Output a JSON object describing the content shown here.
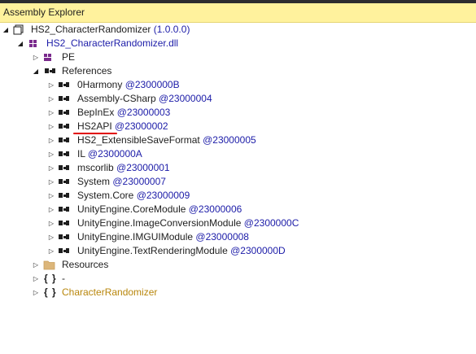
{
  "panel": {
    "title": "Assembly Explorer"
  },
  "assembly": {
    "name": "HS2_CharacterRandomizer",
    "version": "(1.0.0.0)"
  },
  "module": {
    "name": "HS2_CharacterRandomizer.dll"
  },
  "nodes": {
    "pe": "PE",
    "references": "References",
    "resources": "Resources",
    "ns_empty": "-",
    "ns_main": "CharacterRandomizer"
  },
  "references": [
    {
      "name": "0Harmony",
      "token": "@2300000B"
    },
    {
      "name": "Assembly-CSharp",
      "token": "@23000004"
    },
    {
      "name": "BepInEx",
      "token": "@23000003"
    },
    {
      "name": "HS2API",
      "token": "@23000002"
    },
    {
      "name": "HS2_ExtensibleSaveFormat",
      "token": "@23000005"
    },
    {
      "name": "IL",
      "token": "@2300000A"
    },
    {
      "name": "mscorlib",
      "token": "@23000001"
    },
    {
      "name": "System",
      "token": "@23000007"
    },
    {
      "name": "System.Core",
      "token": "@23000009"
    },
    {
      "name": "UnityEngine.CoreModule",
      "token": "@23000006"
    },
    {
      "name": "UnityEngine.ImageConversionModule",
      "token": "@2300000C"
    },
    {
      "name": "UnityEngine.IMGUIModule",
      "token": "@23000008"
    },
    {
      "name": "UnityEngine.TextRenderingModule",
      "token": "@2300000D"
    }
  ],
  "colors": {
    "titlebar": "#fff29d",
    "token": "#1c1ca8",
    "namespace": "#b8860b",
    "highlight-underline": "#e00000"
  }
}
